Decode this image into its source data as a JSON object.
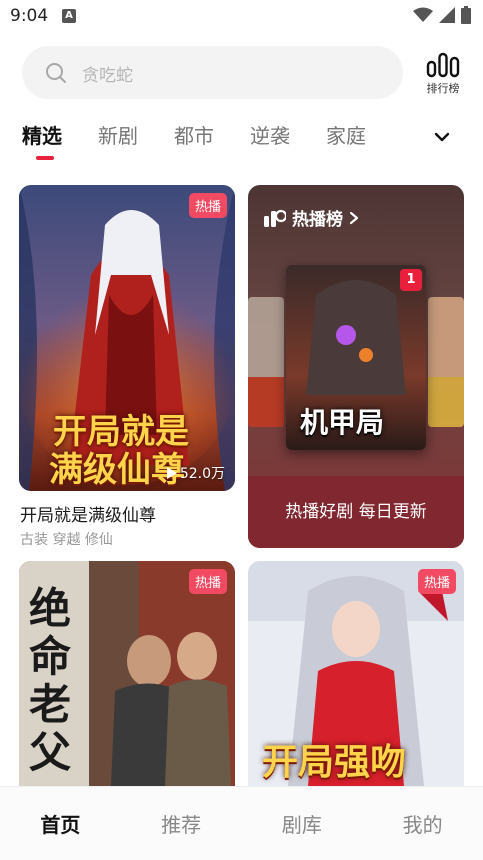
{
  "status": {
    "time": "9:04",
    "a_icon": "A"
  },
  "search": {
    "placeholder": "贪吃蛇"
  },
  "ranking_button": {
    "label": "排行榜"
  },
  "tabs": [
    {
      "label": "精选",
      "active": true
    },
    {
      "label": "新剧"
    },
    {
      "label": "都市"
    },
    {
      "label": "逆袭"
    },
    {
      "label": "家庭"
    }
  ],
  "cards": {
    "card1": {
      "badge": "热播",
      "cover_title_line1": "开局就是",
      "cover_title_line2": "满级仙尊",
      "play_count": "52.0万",
      "title": "开局就是满级仙尊",
      "tags": "古装 穿越 修仙"
    },
    "card2": {
      "badge": "热播",
      "cover_title": "绝命老父"
    },
    "card3": {
      "badge": "热播",
      "cover_title": "开局强吻"
    }
  },
  "hot_ranking": {
    "header": "热播榜",
    "rank_number": "1",
    "cover_title": "机甲局",
    "footer": "热播好剧 每日更新"
  },
  "bottom_nav": [
    {
      "label": "首页",
      "active": true
    },
    {
      "label": "推荐"
    },
    {
      "label": "剧库"
    },
    {
      "label": "我的"
    }
  ],
  "colors": {
    "accent": "#e8213d",
    "badge": "#f24a62",
    "rank_footer": "#80272f"
  }
}
